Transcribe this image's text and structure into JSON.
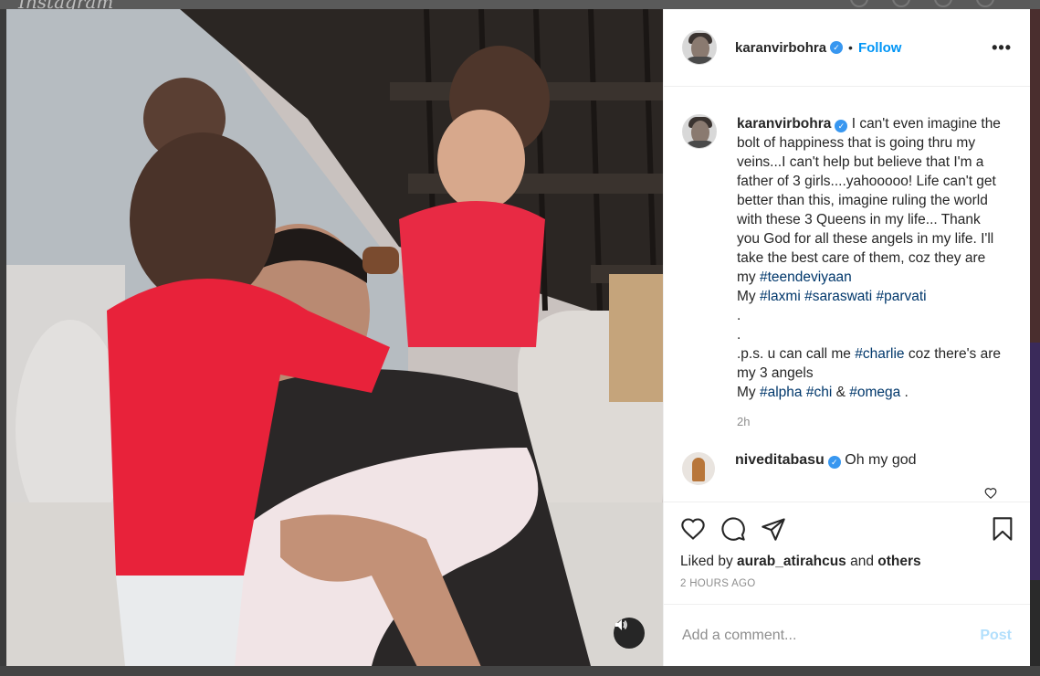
{
  "background": {
    "logo_text": "Instagram"
  },
  "post": {
    "username": "karanvirbohra",
    "follow_label": "Follow",
    "more_label": "•••",
    "caption_parts": [
      {
        "text": "I can't even imagine the bolt of happiness that is going thru my veins...I can't help but believe that I'm a father of 3 girls....yahooooo! Life can't get better than this, imagine ruling the world with these 3 Queens in my life... Thank you God for all these angels in my life. I'll take the best care of them, coz they are my ",
        "tag": false
      },
      {
        "text": "#teendeviyaan",
        "tag": true
      },
      {
        "text": "\nMy ",
        "tag": false
      },
      {
        "text": "#laxmi",
        "tag": true
      },
      {
        "text": " ",
        "tag": false
      },
      {
        "text": "#saraswati",
        "tag": true
      },
      {
        "text": " ",
        "tag": false
      },
      {
        "text": "#parvati",
        "tag": true
      },
      {
        "text": "\n.\n.\n.p.s. u can call me ",
        "tag": false
      },
      {
        "text": "#charlie",
        "tag": true
      },
      {
        "text": " coz there's are my 3 angels\nMy ",
        "tag": false
      },
      {
        "text": "#alpha",
        "tag": true
      },
      {
        "text": " ",
        "tag": false
      },
      {
        "text": "#chi",
        "tag": true
      },
      {
        "text": " & ",
        "tag": false
      },
      {
        "text": "#omega",
        "tag": true
      },
      {
        "text": " .",
        "tag": false
      }
    ],
    "caption_time": "2h",
    "comment": {
      "username": "niveditabasu",
      "text": "Oh my god"
    },
    "likes_prefix": "Liked by ",
    "likes_user": "aurab_atirahcus",
    "likes_mid": " and ",
    "likes_others": "others",
    "post_time": "2 HOURS AGO",
    "comment_placeholder": "Add a comment...",
    "post_label": "Post"
  },
  "colors": {
    "accent": "#0095f6",
    "hashtag": "#00376b",
    "verified": "#3897f0"
  },
  "icons": [
    "volume-icon",
    "verified-icon",
    "more-icon",
    "heart-icon",
    "comment-icon",
    "share-icon",
    "bookmark-icon"
  ]
}
